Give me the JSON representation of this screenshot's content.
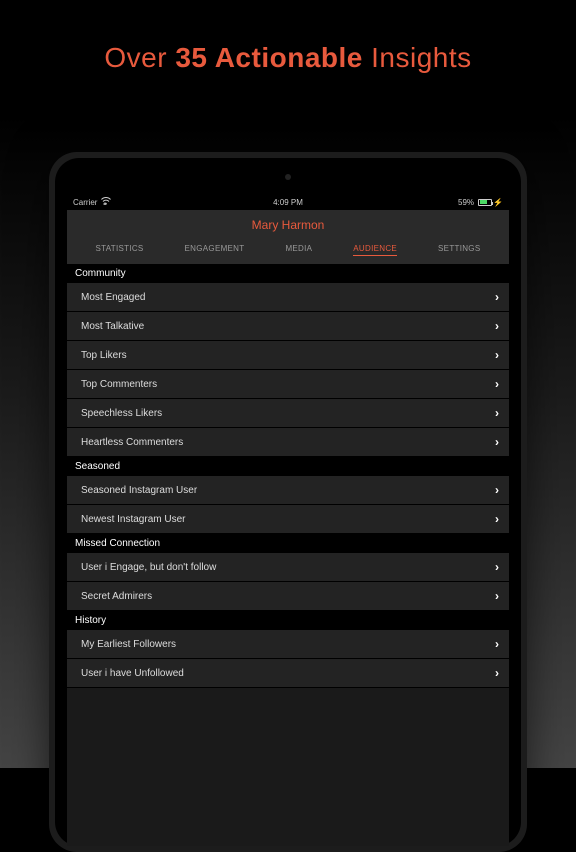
{
  "headline": {
    "pre": "Over ",
    "bold": "35 Actionable",
    "post": " Insights"
  },
  "status": {
    "carrier": "Carrier",
    "time": "4:09 PM",
    "battery_pct": "59%"
  },
  "nav": {
    "title": "Mary Harmon"
  },
  "tabs": [
    {
      "label": "STATISTICS",
      "active": false
    },
    {
      "label": "ENGAGEMENT",
      "active": false
    },
    {
      "label": "MEDIA",
      "active": false
    },
    {
      "label": "AUDIENCE",
      "active": true
    },
    {
      "label": "SETTINGS",
      "active": false
    }
  ],
  "sections": [
    {
      "header": "Community",
      "rows": [
        "Most Engaged",
        "Most Talkative",
        "Top Likers",
        "Top Commenters",
        "Speechless Likers",
        "Heartless Commenters"
      ]
    },
    {
      "header": "Seasoned",
      "rows": [
        "Seasoned Instagram User",
        "Newest Instagram User"
      ]
    },
    {
      "header": "Missed Connection",
      "rows": [
        "User i Engage, but don't follow",
        "Secret Admirers"
      ]
    },
    {
      "header": "History",
      "rows": [
        "My Earliest Followers",
        "User i have Unfollowed"
      ]
    }
  ]
}
